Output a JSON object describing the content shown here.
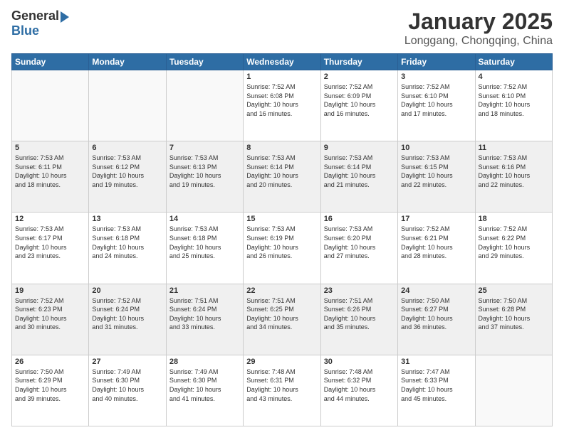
{
  "logo": {
    "general": "General",
    "blue": "Blue"
  },
  "header": {
    "title": "January 2025",
    "location": "Longgang, Chongqing, China"
  },
  "days_of_week": [
    "Sunday",
    "Monday",
    "Tuesday",
    "Wednesday",
    "Thursday",
    "Friday",
    "Saturday"
  ],
  "weeks": [
    [
      {
        "day": "",
        "info": ""
      },
      {
        "day": "",
        "info": ""
      },
      {
        "day": "",
        "info": ""
      },
      {
        "day": "1",
        "info": "Sunrise: 7:52 AM\nSunset: 6:08 PM\nDaylight: 10 hours\nand 16 minutes."
      },
      {
        "day": "2",
        "info": "Sunrise: 7:52 AM\nSunset: 6:09 PM\nDaylight: 10 hours\nand 16 minutes."
      },
      {
        "day": "3",
        "info": "Sunrise: 7:52 AM\nSunset: 6:10 PM\nDaylight: 10 hours\nand 17 minutes."
      },
      {
        "day": "4",
        "info": "Sunrise: 7:52 AM\nSunset: 6:10 PM\nDaylight: 10 hours\nand 18 minutes."
      }
    ],
    [
      {
        "day": "5",
        "info": "Sunrise: 7:53 AM\nSunset: 6:11 PM\nDaylight: 10 hours\nand 18 minutes."
      },
      {
        "day": "6",
        "info": "Sunrise: 7:53 AM\nSunset: 6:12 PM\nDaylight: 10 hours\nand 19 minutes."
      },
      {
        "day": "7",
        "info": "Sunrise: 7:53 AM\nSunset: 6:13 PM\nDaylight: 10 hours\nand 19 minutes."
      },
      {
        "day": "8",
        "info": "Sunrise: 7:53 AM\nSunset: 6:14 PM\nDaylight: 10 hours\nand 20 minutes."
      },
      {
        "day": "9",
        "info": "Sunrise: 7:53 AM\nSunset: 6:14 PM\nDaylight: 10 hours\nand 21 minutes."
      },
      {
        "day": "10",
        "info": "Sunrise: 7:53 AM\nSunset: 6:15 PM\nDaylight: 10 hours\nand 22 minutes."
      },
      {
        "day": "11",
        "info": "Sunrise: 7:53 AM\nSunset: 6:16 PM\nDaylight: 10 hours\nand 22 minutes."
      }
    ],
    [
      {
        "day": "12",
        "info": "Sunrise: 7:53 AM\nSunset: 6:17 PM\nDaylight: 10 hours\nand 23 minutes."
      },
      {
        "day": "13",
        "info": "Sunrise: 7:53 AM\nSunset: 6:18 PM\nDaylight: 10 hours\nand 24 minutes."
      },
      {
        "day": "14",
        "info": "Sunrise: 7:53 AM\nSunset: 6:18 PM\nDaylight: 10 hours\nand 25 minutes."
      },
      {
        "day": "15",
        "info": "Sunrise: 7:53 AM\nSunset: 6:19 PM\nDaylight: 10 hours\nand 26 minutes."
      },
      {
        "day": "16",
        "info": "Sunrise: 7:53 AM\nSunset: 6:20 PM\nDaylight: 10 hours\nand 27 minutes."
      },
      {
        "day": "17",
        "info": "Sunrise: 7:52 AM\nSunset: 6:21 PM\nDaylight: 10 hours\nand 28 minutes."
      },
      {
        "day": "18",
        "info": "Sunrise: 7:52 AM\nSunset: 6:22 PM\nDaylight: 10 hours\nand 29 minutes."
      }
    ],
    [
      {
        "day": "19",
        "info": "Sunrise: 7:52 AM\nSunset: 6:23 PM\nDaylight: 10 hours\nand 30 minutes."
      },
      {
        "day": "20",
        "info": "Sunrise: 7:52 AM\nSunset: 6:24 PM\nDaylight: 10 hours\nand 31 minutes."
      },
      {
        "day": "21",
        "info": "Sunrise: 7:51 AM\nSunset: 6:24 PM\nDaylight: 10 hours\nand 33 minutes."
      },
      {
        "day": "22",
        "info": "Sunrise: 7:51 AM\nSunset: 6:25 PM\nDaylight: 10 hours\nand 34 minutes."
      },
      {
        "day": "23",
        "info": "Sunrise: 7:51 AM\nSunset: 6:26 PM\nDaylight: 10 hours\nand 35 minutes."
      },
      {
        "day": "24",
        "info": "Sunrise: 7:50 AM\nSunset: 6:27 PM\nDaylight: 10 hours\nand 36 minutes."
      },
      {
        "day": "25",
        "info": "Sunrise: 7:50 AM\nSunset: 6:28 PM\nDaylight: 10 hours\nand 37 minutes."
      }
    ],
    [
      {
        "day": "26",
        "info": "Sunrise: 7:50 AM\nSunset: 6:29 PM\nDaylight: 10 hours\nand 39 minutes."
      },
      {
        "day": "27",
        "info": "Sunrise: 7:49 AM\nSunset: 6:30 PM\nDaylight: 10 hours\nand 40 minutes."
      },
      {
        "day": "28",
        "info": "Sunrise: 7:49 AM\nSunset: 6:30 PM\nDaylight: 10 hours\nand 41 minutes."
      },
      {
        "day": "29",
        "info": "Sunrise: 7:48 AM\nSunset: 6:31 PM\nDaylight: 10 hours\nand 43 minutes."
      },
      {
        "day": "30",
        "info": "Sunrise: 7:48 AM\nSunset: 6:32 PM\nDaylight: 10 hours\nand 44 minutes."
      },
      {
        "day": "31",
        "info": "Sunrise: 7:47 AM\nSunset: 6:33 PM\nDaylight: 10 hours\nand 45 minutes."
      },
      {
        "day": "",
        "info": ""
      }
    ]
  ]
}
